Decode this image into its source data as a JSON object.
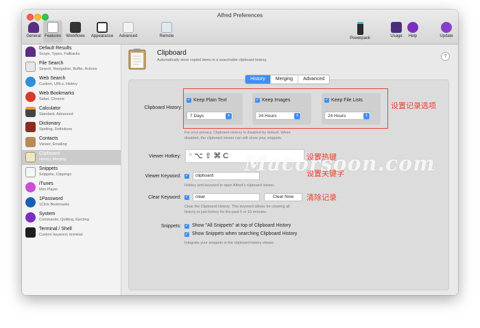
{
  "window": {
    "title": "Alfred Preferences"
  },
  "toolbar": {
    "items": [
      {
        "label": "General",
        "icon": "hat-icon"
      },
      {
        "label": "Features",
        "icon": "checklist-icon"
      },
      {
        "label": "Workflows",
        "icon": "workflows-icon"
      },
      {
        "label": "Appearance",
        "icon": "appearance-icon"
      },
      {
        "label": "Advanced",
        "icon": "advanced-icon"
      },
      {
        "label": "Remote",
        "icon": "remote-icon"
      },
      {
        "label": "Powerpack",
        "icon": "powerpack-icon"
      },
      {
        "label": "Usage",
        "icon": "usage-icon"
      },
      {
        "label": "Help",
        "icon": "help-icon"
      },
      {
        "label": "Update",
        "icon": "update-icon"
      }
    ]
  },
  "sidebar": {
    "items": [
      {
        "title": "Default Results",
        "subtitle": "Scope, Types, Fallbacks"
      },
      {
        "title": "File Search",
        "subtitle": "Search, Navigation, Buffer, Actions"
      },
      {
        "title": "Web Search",
        "subtitle": "Custom, URLs, History"
      },
      {
        "title": "Web Bookmarks",
        "subtitle": "Safari, Chrome"
      },
      {
        "title": "Calculator",
        "subtitle": "Standard, Advanced"
      },
      {
        "title": "Dictionary",
        "subtitle": "Spelling, Definitions"
      },
      {
        "title": "Contacts",
        "subtitle": "Viewer, Emailing"
      },
      {
        "title": "Clipboard",
        "subtitle": "History, Merging"
      },
      {
        "title": "Snippets",
        "subtitle": "Snippets, Clippings"
      },
      {
        "title": "iTunes",
        "subtitle": "Mini Player"
      },
      {
        "title": "1Password",
        "subtitle": "1Click Bookmarks"
      },
      {
        "title": "System",
        "subtitle": "Commands, Quitting, Ejecting"
      },
      {
        "title": "Terminal / Shell",
        "subtitle": "Custom keyword, terminal"
      }
    ]
  },
  "header": {
    "title": "Clipboard",
    "subtitle": "Automatically store copied items in a searchable clipboard history.",
    "help": "?"
  },
  "tabs": [
    "History",
    "Merging",
    "Advanced"
  ],
  "history": {
    "label": "Clipboard History:",
    "groups": [
      {
        "check_label": "Keep Plain Text",
        "value": "7 Days"
      },
      {
        "check_label": "Keep Images",
        "value": "24 Hours"
      },
      {
        "check_label": "Keep File Lists",
        "value": "24 Hours"
      }
    ],
    "privacy_note_1": "For your privacy, Clipboard History is disabled by default. When",
    "privacy_note_2": "disabled, the clipboard viewer can still show your snippets."
  },
  "viewer_hotkey": {
    "label": "Viewer Hotkey:",
    "prefix": "^",
    "keys": "⌥ ⇧ ⌘ C"
  },
  "viewer_keyword": {
    "label": "Viewer Keyword:",
    "value": "clipboard",
    "note": "Hotkey and keyword to open Alfred's clipboard viewer."
  },
  "clear_keyword": {
    "label": "Clear Keyword:",
    "value": "clear",
    "button": "Clear Now",
    "note_1": "Clear the Clipboard History. This keyword allows for clearing all",
    "note_2": "history or just history for the past 5 or 15 minutes."
  },
  "snippets": {
    "label": "Snippets:",
    "option_1": "Show \"All Snippets\" at top of Clipboard History",
    "option_2": "Show Snippets when searching Clipboard History",
    "note": "Integrate your snippets in the clipboard history viewer."
  },
  "annotations": {
    "history_options": "设置记录选项",
    "hotkey": "设置热键",
    "keyword": "设置关键字",
    "clear": "清除记录"
  },
  "watermark": "Macorsoon.com",
  "colors": {
    "accent": "#3f8ef2",
    "annotation": "#e8432f"
  }
}
